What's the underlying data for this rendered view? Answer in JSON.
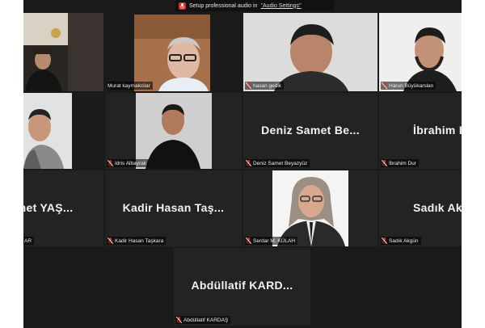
{
  "banner": {
    "text": "Setup professional audio in",
    "link": "\"Audio Settings\""
  },
  "tiles": [
    {
      "name": ""
    },
    {
      "name": "Murat kaymakcilar"
    },
    {
      "name": "hasan gedik"
    },
    {
      "name": "Harun Büyükarslan"
    },
    {
      "name": ""
    },
    {
      "name": "Idris Albayrak"
    },
    {
      "name": "Deniz Samet Beyazyüz",
      "big": "Deniz Samet Be..."
    },
    {
      "name": "İbrahim Dur",
      "big": "İbrahim I"
    },
    {
      "name": "AR",
      "big": "mmet YAŞ..."
    },
    {
      "name": "Kadir Hasan Taşkara",
      "big": "Kadir Hasan Taş..."
    },
    {
      "name": "Serdar M. KÜLAH"
    },
    {
      "name": "Sadık Akgün",
      "big": "Sadık Akgi"
    },
    {
      "name": "Abdüllatif KARDAŞ",
      "big": "Abdüllatif KARD..."
    }
  ],
  "colors": {
    "active_border": "#e6e84a",
    "muted_mic": "#d93025",
    "tile_bg": "#232323"
  },
  "icons": {
    "muted": "mic-muted-icon",
    "banner": "mic-icon"
  }
}
